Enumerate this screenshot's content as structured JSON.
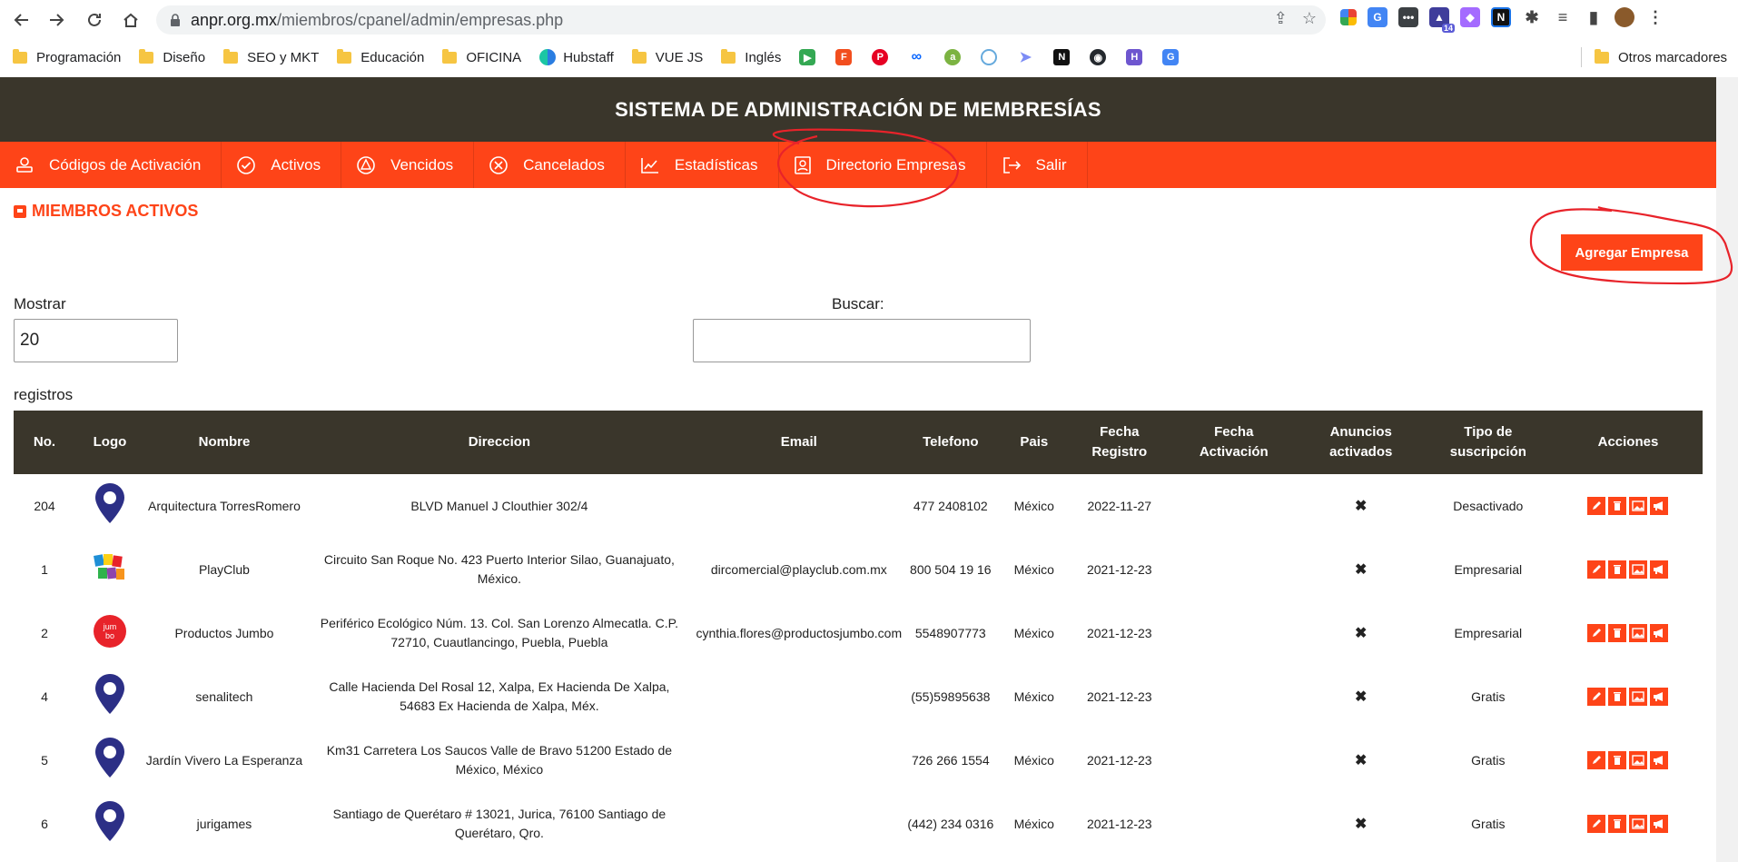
{
  "browser": {
    "url_host": "anpr.org.mx",
    "url_path": "/miembros/cpanel/admin/empresas.php",
    "bookmarks": [
      {
        "label": "Programación",
        "type": "folder"
      },
      {
        "label": "Diseño",
        "type": "folder"
      },
      {
        "label": "SEO y MKT",
        "type": "folder"
      },
      {
        "label": "Educación",
        "type": "folder"
      },
      {
        "label": "OFICINA",
        "type": "folder"
      },
      {
        "label": "Hubstaff",
        "type": "site"
      },
      {
        "label": "VUE JS",
        "type": "folder"
      },
      {
        "label": "Inglés",
        "type": "folder"
      }
    ],
    "other_bookmarks": "Otros marcadores",
    "ext_badge": "14"
  },
  "app": {
    "title": "SISTEMA DE ADMINISTRACIÓN DE MEMBRESÍAS",
    "nav": [
      {
        "label": "Códigos de Activación",
        "icon": "activation-icon"
      },
      {
        "label": "Activos",
        "icon": "check-circle-icon"
      },
      {
        "label": "Vencidos",
        "icon": "warning-icon"
      },
      {
        "label": "Cancelados",
        "icon": "cancel-circle-icon"
      },
      {
        "label": "Estadísticas",
        "icon": "chart-icon"
      },
      {
        "label": "Directorio Empresas",
        "icon": "directory-icon"
      },
      {
        "label": "Salir",
        "icon": "logout-icon"
      }
    ],
    "section_title": "MIEMBROS ACTIVOS",
    "add_button": "Agregar Empresa",
    "show_label": "Mostrar",
    "show_value": "20",
    "search_label": "Buscar:",
    "search_value": "",
    "records_label": "registros",
    "accent_color": "#fe4418",
    "header_color": "#3a362b"
  },
  "table": {
    "headers": [
      "No.",
      "Logo",
      "Nombre",
      "Direccion",
      "Email",
      "Telefono",
      "Pais",
      "Fecha Registro",
      "Fecha Activación",
      "Anuncios activados",
      "Tipo de suscripción",
      "Acciones"
    ],
    "rows": [
      {
        "no": "204",
        "logo": "pin",
        "nombre": "Arquitectura TorresRomero",
        "direccion": "BLVD Manuel J Clouthier 302/4",
        "email": "",
        "telefono": "477 2408102",
        "pais": "México",
        "registro": "2022-11-27",
        "activacion": "",
        "anuncios": "✖",
        "tipo": "Desactivado"
      },
      {
        "no": "1",
        "logo": "playclub",
        "nombre": "PlayClub",
        "direccion": "Circuito San Roque No. 423 Puerto Interior Silao, Guanajuato, México.",
        "email": "dircomercial@playclub.com.mx",
        "telefono": "800 504 19 16",
        "pais": "México",
        "registro": "2021-12-23",
        "activacion": "",
        "anuncios": "✖",
        "tipo": "Empresarial"
      },
      {
        "no": "2",
        "logo": "jumbo",
        "nombre": "Productos Jumbo",
        "direccion": "Periférico Ecológico Núm. 13. Col. San Lorenzo Almecatla. C.P. 72710, Cuautlancingo, Puebla, Puebla",
        "email": "cynthia.flores@productosjumbo.com",
        "telefono": "5548907773",
        "pais": "México",
        "registro": "2021-12-23",
        "activacion": "",
        "anuncios": "✖",
        "tipo": "Empresarial"
      },
      {
        "no": "4",
        "logo": "pin",
        "nombre": "senalitech",
        "direccion": "Calle Hacienda Del Rosal 12, Xalpa, Ex Hacienda De Xalpa, 54683 Ex Hacienda de Xalpa, Méx.",
        "email": "",
        "telefono": "(55)59895638",
        "pais": "México",
        "registro": "2021-12-23",
        "activacion": "",
        "anuncios": "✖",
        "tipo": "Gratis"
      },
      {
        "no": "5",
        "logo": "pin",
        "nombre": "Jardín Vivero La Esperanza",
        "direccion": "Km31 Carretera Los Saucos Valle de Bravo 51200 Estado de México, México",
        "email": "",
        "telefono": "726 266 1554",
        "pais": "México",
        "registro": "2021-12-23",
        "activacion": "",
        "anuncios": "✖",
        "tipo": "Gratis"
      },
      {
        "no": "6",
        "logo": "pin",
        "nombre": "jurigames",
        "direccion": "Santiago de Querétaro # 13021, Jurica, 76100 Santiago de Querétaro, Qro.",
        "email": "",
        "telefono": "(442) 234 0316",
        "pais": "México",
        "registro": "2021-12-23",
        "activacion": "",
        "anuncios": "✖",
        "tipo": "Gratis"
      }
    ]
  }
}
